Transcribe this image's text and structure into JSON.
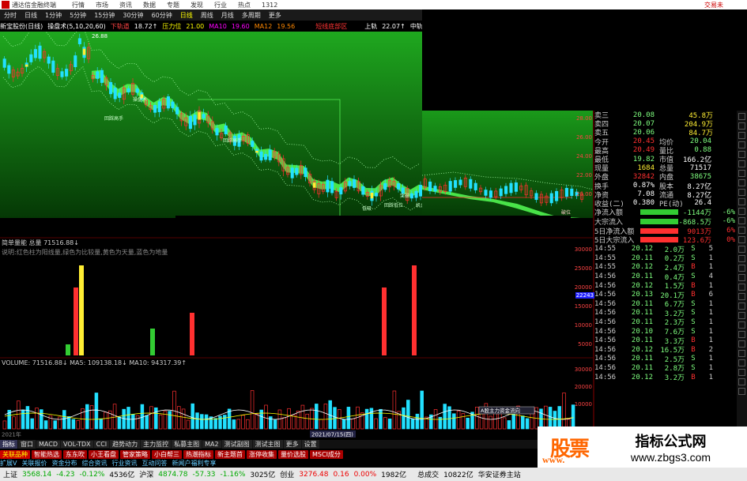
{
  "titlebar": {
    "app_name": "通达信金融终端",
    "tabs": [
      "行情",
      "市场",
      "资讯",
      "数据",
      "专题",
      "发现",
      "行业",
      "热点",
      "1312"
    ],
    "right_link": "交易未"
  },
  "menubar": {
    "items": [
      "分时",
      "日线",
      "1分钟",
      "5分钟",
      "15分钟",
      "30分钟",
      "60分钟",
      "日线",
      "周线",
      "月线",
      "多周期",
      "更多"
    ],
    "active_index": 7
  },
  "infobar": {
    "stock": "新宝股份(日线)",
    "mode": "操盘术(5,10,20,60)",
    "lower_rail_label": "下轨道",
    "lower_rail_val": "18.72↑",
    "pressure_label": "压力位",
    "pressure_val": "21.00",
    "ma10_label": "MA10",
    "ma10_val": "19.60",
    "ma12_label": "MA12",
    "ma12_val": "19.56",
    "warn": "短线底部区",
    "upper_rail_label": "上轨",
    "upper_rail_val": "22.07↑",
    "mid_label": "中轨道"
  },
  "chart_labels": {
    "price_top": "26.88",
    "low_label": "19.82",
    "annot1": "操盘术",
    "annot2": "低吸",
    "annot3": "回踩高手",
    "annot4": "回踩高手",
    "annot5": "机会",
    "annot6": "破位",
    "annot7": "回踩低位",
    "annot8": "突破"
  },
  "right_scale": {
    "vals": [
      "28.00",
      "26.00",
      "24.00",
      "22.00",
      "20.00"
    ],
    "vol_vals": [
      "30000",
      "25000",
      "20000",
      "15000",
      "10000",
      "5000"
    ],
    "vol2_vals": [
      "30000",
      "20000",
      "10000"
    ],
    "marker": "22243"
  },
  "mid_panel": {
    "title": "简单量能 总量 71516.88↓",
    "subtitle": "说明:红色柱为阳线量,绿色为比较量,黄色为天量,蓝色为地量"
  },
  "vol_panel": {
    "title": "VOLUME: 71516.88↓  MA5: 109138.18↓  MA10: 94317.39↑",
    "date_label": "2021/07/15(四)",
    "flag": "A股主力资金流向",
    "year_label": "2021年"
  },
  "quote_panel": {
    "bids": [
      {
        "l": "卖三",
        "v": "20.08",
        "v2": "45.8万"
      },
      {
        "l": "卖四",
        "v": "20.07",
        "v2": "204.9万"
      },
      {
        "l": "卖五",
        "v": "20.06",
        "v2": "84.7万"
      }
    ],
    "stats": [
      {
        "l": "今开",
        "v": "20.45",
        "l2": "均价",
        "v2": "20.04",
        "c": "red",
        "c2": "grn"
      },
      {
        "l": "最高",
        "v": "20.49",
        "l2": "量比",
        "v2": "0.88",
        "c": "red",
        "c2": "grn"
      },
      {
        "l": "最低",
        "v": "19.82",
        "l2": "市值",
        "v2": "166.2亿",
        "c": "grn",
        "c2": "w"
      },
      {
        "l": "现量",
        "v": "1684",
        "l2": "总量",
        "v2": "71517",
        "c": "y",
        "c2": "w"
      },
      {
        "l": "外盘",
        "v": "32842",
        "l2": "内盘",
        "v2": "38675",
        "c": "red",
        "c2": "grn"
      },
      {
        "l": "换手",
        "v": "0.87%",
        "l2": "股本",
        "v2": "8.27亿",
        "c": "w",
        "c2": "w"
      },
      {
        "l": "净资",
        "v": "7.08",
        "l2": "流通",
        "v2": "8.27亿",
        "c": "w",
        "c2": "w"
      },
      {
        "l": "收益(二)",
        "v": "0.380",
        "l2": "PE(动)",
        "v2": "26.4",
        "c": "w",
        "c2": "w"
      }
    ],
    "flows": [
      {
        "l": "净流入额",
        "v": "-1144万",
        "p": "-6%",
        "c": "grn"
      },
      {
        "l": "大宗流入",
        "v": "-868.5万",
        "p": "-6%",
        "c": "grn"
      },
      {
        "l": "5日净流入额",
        "v": "9013万",
        "p": "6%",
        "c": "red"
      },
      {
        "l": "5日大宗流入",
        "v": "123.6万",
        "p": "0%",
        "c": "red"
      }
    ],
    "ticks": [
      {
        "t": "14:55",
        "p": "20.12",
        "q": "2.0万",
        "s": "S",
        "k": "5"
      },
      {
        "t": "14:55",
        "p": "20.11",
        "q": "0.2万",
        "s": "S",
        "k": "1"
      },
      {
        "t": "14:55",
        "p": "20.12",
        "q": "2.4万",
        "s": "B",
        "k": "1"
      },
      {
        "t": "14:56",
        "p": "20.11",
        "q": "0.4万",
        "s": "S",
        "k": "4"
      },
      {
        "t": "14:56",
        "p": "20.12",
        "q": "1.5万",
        "s": "B",
        "k": "1"
      },
      {
        "t": "14:56",
        "p": "20.13",
        "q": "20.1万",
        "s": "B",
        "k": "6"
      },
      {
        "t": "14:56",
        "p": "20.11",
        "q": "6.7万",
        "s": "S",
        "k": "1"
      },
      {
        "t": "14:56",
        "p": "20.11",
        "q": "3.2万",
        "s": "S",
        "k": "1"
      },
      {
        "t": "14:56",
        "p": "20.11",
        "q": "2.3万",
        "s": "S",
        "k": "1"
      },
      {
        "t": "14:56",
        "p": "20.10",
        "q": "7.6万",
        "s": "S",
        "k": "1"
      },
      {
        "t": "14:56",
        "p": "20.11",
        "q": "3.3万",
        "s": "B",
        "k": "1"
      },
      {
        "t": "14:56",
        "p": "20.12",
        "q": "16.5万",
        "s": "B",
        "k": "2"
      },
      {
        "t": "14:56",
        "p": "20.11",
        "q": "2.5万",
        "s": "S",
        "k": "1"
      },
      {
        "t": "14:56",
        "p": "20.11",
        "q": "2.8万",
        "s": "S",
        "k": "1"
      },
      {
        "t": "14:56",
        "p": "20.12",
        "q": "3.2万",
        "s": "B",
        "k": "1"
      }
    ]
  },
  "funcbar": [
    "指标",
    "窗口",
    "MACD",
    "VOL-TDX",
    "CCI",
    "趋势动力",
    "主力监控",
    "私募主图",
    "MA2",
    "测试副图",
    "测试主图",
    "更多",
    "设置"
  ],
  "tagbar": [
    "关联品种",
    "智能热选",
    "东东吹",
    "小王看盘",
    "管家策略",
    "小白帮三",
    "热潮指标",
    "新主题首",
    "涨停收集",
    "量价选股",
    "MSCI成分"
  ],
  "linkbar": [
    "扩展V",
    "关联报价",
    "资金分布",
    "综合资讯",
    "行业资讯",
    "互动问答",
    "新闻户福利专享"
  ],
  "statusbar": {
    "sh_label": "上证",
    "sh_val": "3568.14",
    "sh_chg": "-4.23",
    "sh_pct": "-0.12%",
    "sh_amt": "4536亿",
    "sz_label": "沪深",
    "sz_val": "4874.78",
    "sz_chg": "-57.33",
    "sz_pct": "-1.16%",
    "sz_amt": "3025亿",
    "cy_label": "创业",
    "cy_val": "3276.48",
    "cy_chg": "0.16",
    "cy_pct": "0.00%",
    "cy_amt": "1982亿",
    "total_label": "总成交",
    "total_val": "10822亿",
    "broker": "华安证券主站"
  },
  "watermark": {
    "brand": "股票",
    "url": "www.",
    "title": "指标公式网",
    "site": "www.zbgs3.com"
  },
  "colors": {
    "up": "#ff3030",
    "down": "#00e0ff",
    "green_bar": "#33cc33",
    "yellow_bar": "#ffee33",
    "blue_bar": "#2233ff",
    "band": "#66ff66"
  }
}
